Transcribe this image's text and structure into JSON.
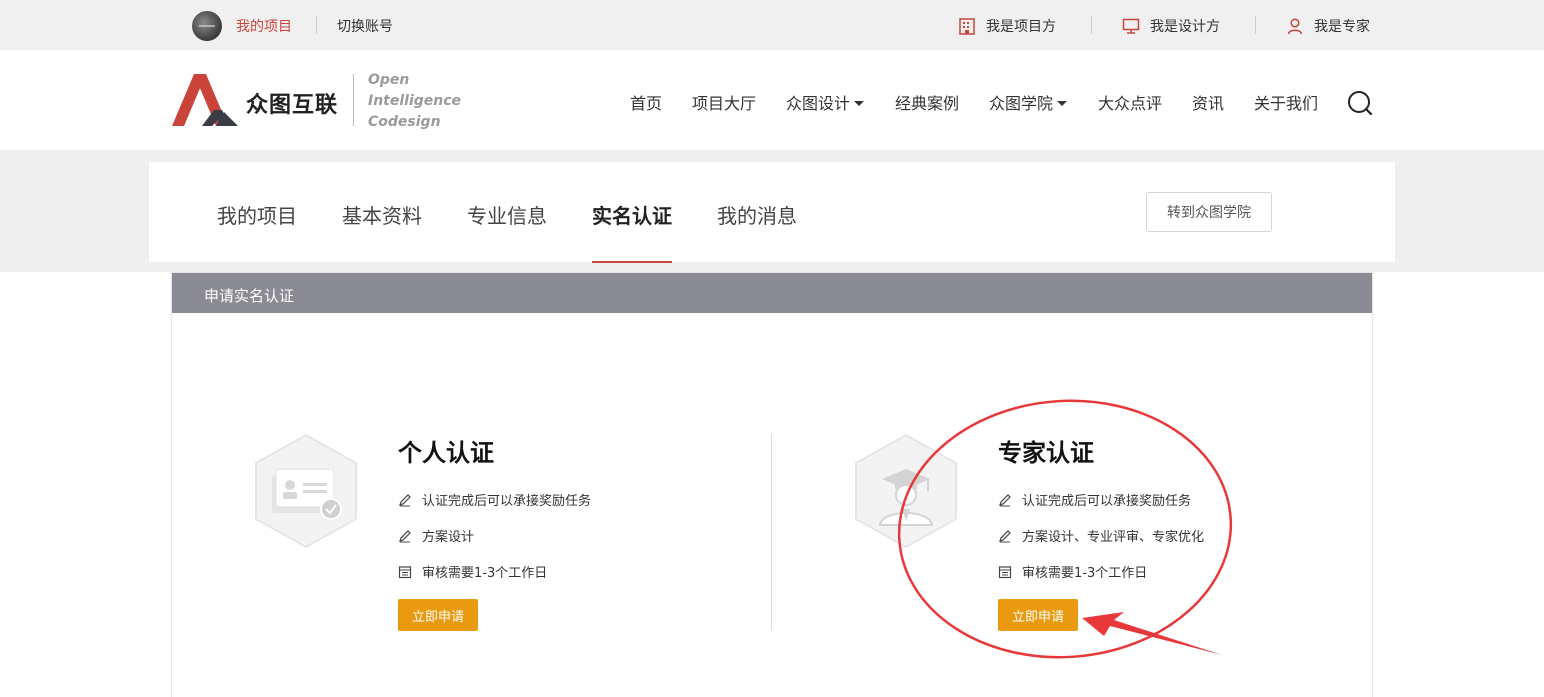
{
  "topbar": {
    "my_projects": "我的项目",
    "switch_account": "切换账号",
    "roles": [
      {
        "label": "我是项目方",
        "icon": "building-icon"
      },
      {
        "label": "我是设计方",
        "icon": "monitor-icon"
      },
      {
        "label": "我是专家",
        "icon": "user-icon"
      }
    ]
  },
  "header": {
    "logo_text": "众图互联",
    "logo_sub": [
      "Open",
      "Intelligence",
      "Codesign"
    ],
    "nav": [
      "首页",
      "项目大厅",
      "众图设计",
      "经典案例",
      "众图学院",
      "大众点评",
      "资讯",
      "关于我们"
    ]
  },
  "tabs": {
    "items": [
      "我的项目",
      "基本资料",
      "专业信息",
      "实名认证",
      "我的消息"
    ],
    "active": "实名认证",
    "academy_button": "转到众图学院"
  },
  "panel": {
    "title": "申请实名认证",
    "cards": [
      {
        "title": "个人认证",
        "lines": [
          "认证完成后可以承接奖励任务",
          "方案设计",
          "审核需要1-3个工作日"
        ],
        "button": "立即申请"
      },
      {
        "title": "专家认证",
        "lines": [
          "认证完成后可以承接奖励任务",
          "方案设计、专业评审、专家优化",
          "审核需要1-3个工作日"
        ],
        "button": "立即申请"
      }
    ]
  },
  "colors": {
    "accent_red": "#c9453b",
    "button_orange": "#e99a11",
    "panel_header": "#8a8b93",
    "annotation_red": "#e8393a"
  }
}
